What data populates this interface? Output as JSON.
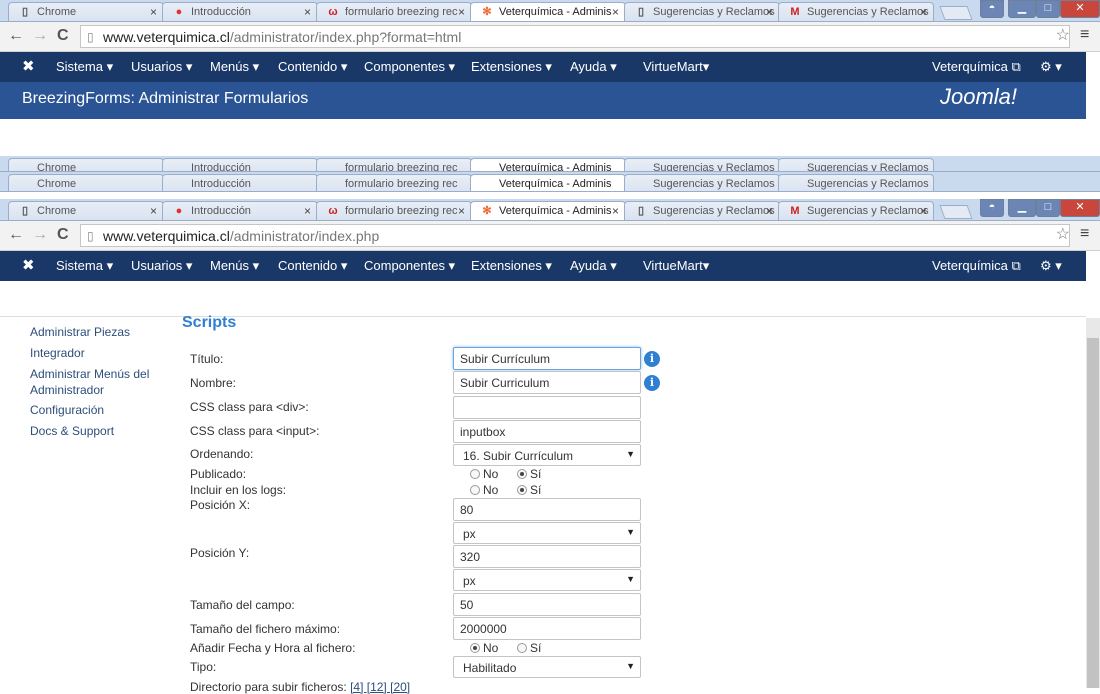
{
  "tab_labels": [
    "Chrome",
    "Introducción",
    "formulario breezing rec",
    "Veterquímica - Adminis",
    "Sugerencias y Reclamos",
    "Sugerencias y Reclamos"
  ],
  "tab_close": "×",
  "url_top": {
    "domain": "www.veterquimica.cl",
    "path": "/administrator/index.php?format=html"
  },
  "url_bottom": {
    "domain": "www.veterquimica.cl",
    "path": "/administrator/index.php"
  },
  "nav": {
    "joomla_icon": "joomla-icon",
    "items": [
      "Sistema ▾",
      "Usuarios ▾",
      "Menús ▾",
      "Contenido ▾",
      "Componentes ▾",
      "Extensiones ▾",
      "Ayuda ▾",
      "VirtueMart▾"
    ],
    "site": "Veterquímica ⧉",
    "gear": "⚙ ▾"
  },
  "header": {
    "title": "BreezingForms: Administrar Formularios",
    "logo": "Joomla!"
  },
  "sidebar": [
    "Administrar Piezas",
    "Integrador",
    "Administrar Menús del Administrador",
    "Configuración",
    "Docs & Support"
  ],
  "section_title": "Scripts",
  "form": {
    "titulo_label": "Título:",
    "titulo_value": "Subir Currículum",
    "nombre_label": "Nombre:",
    "nombre_value": "Subir Curriculum",
    "cssdiv_label": "CSS class para <div>:",
    "cssdiv_value": "",
    "cssinput_label": "CSS class para <input>:",
    "cssinput_value": "inputbox",
    "ordenando_label": "Ordenando:",
    "ordenando_value": "16. Subir Currículum",
    "publicado_label": "Publicado:",
    "logs_label": "Incluir en los logs:",
    "posx_label": "Posición X:",
    "posx_value": "80",
    "posx_unit": "px",
    "posy_label": "Posición Y:",
    "posy_value": "320",
    "posy_unit": "px",
    "tamano_label": "Tamaño del campo:",
    "tamano_value": "50",
    "fichero_label": "Tamaño del fichero máximo:",
    "fichero_value": "2000000",
    "fecha_label": "Añadir Fecha y Hora al fichero:",
    "tipo_label": "Tipo:",
    "tipo_value": "Habilitado",
    "dir_label": "Directorio para subir ficheros:",
    "dir_links": "[4] [12] [20]",
    "no": "No",
    "si": "Sí"
  }
}
